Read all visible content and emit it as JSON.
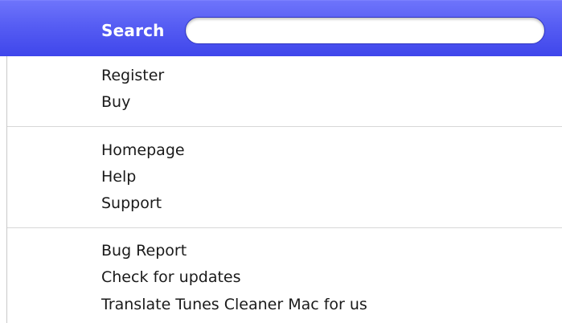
{
  "search": {
    "label": "Search",
    "value": "",
    "placeholder": ""
  },
  "menu": {
    "groups": [
      {
        "items": [
          "Register",
          "Buy"
        ]
      },
      {
        "items": [
          "Homepage",
          "Help",
          "Support"
        ]
      },
      {
        "items": [
          "Bug Report",
          "Check for updates",
          "Translate Tunes Cleaner Mac for us"
        ]
      }
    ]
  },
  "colors": {
    "highlight": "#565df3",
    "separator": "#d7d7d7",
    "text": "#1a1a1a"
  }
}
